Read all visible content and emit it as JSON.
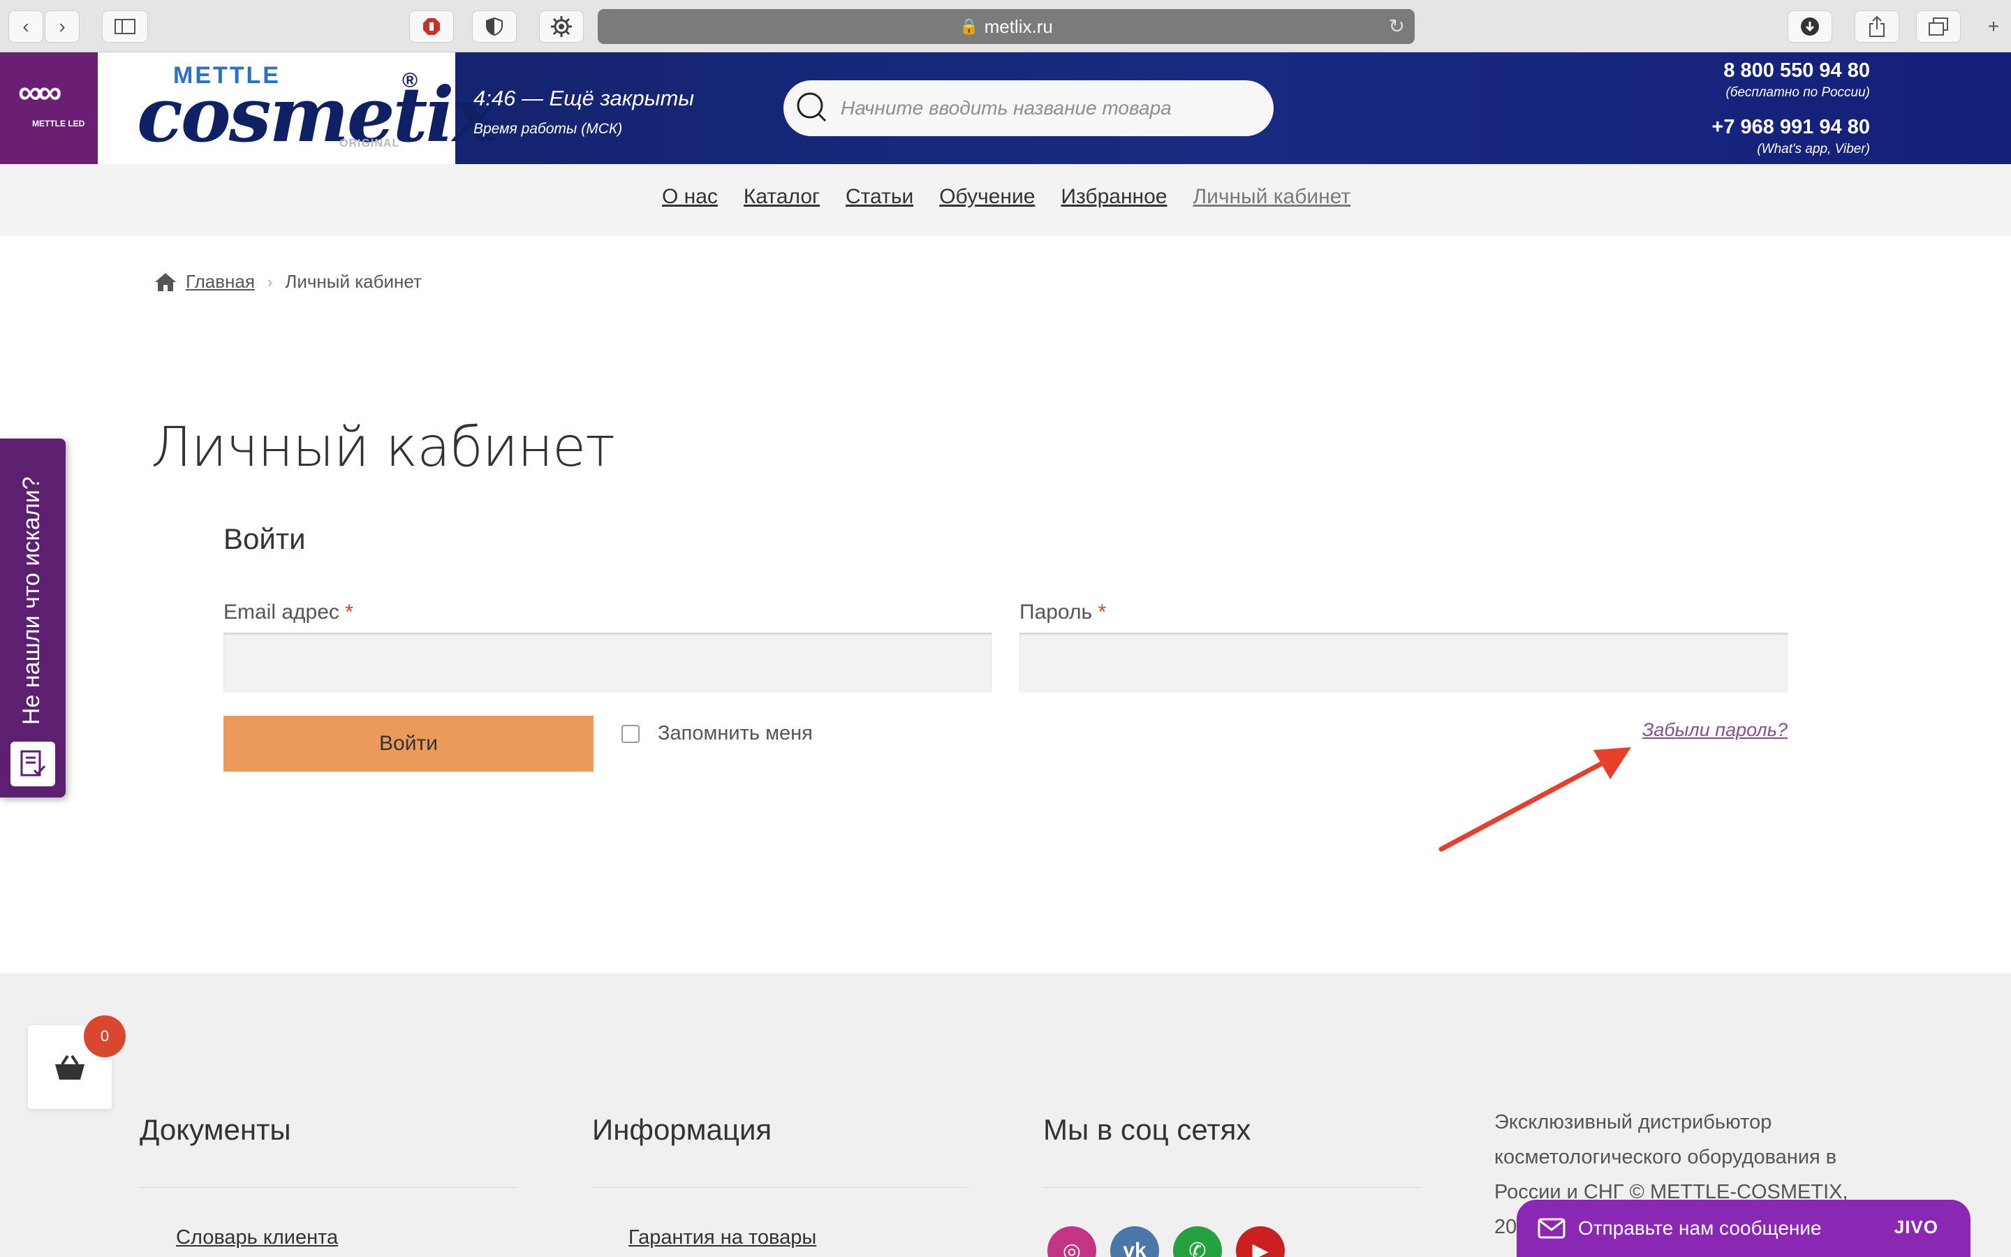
{
  "browser": {
    "url": "metlix.ru"
  },
  "header": {
    "led_brand": "METTLE LED",
    "logo_top": "METTLE",
    "logo_main": "cosmetix",
    "logo_reg": "®",
    "logo_sub": "ORIGINAL",
    "hours_status": "4:46 — Ещё закрыты",
    "hours_note": "Время работы (МСК)",
    "search_placeholder": "Начните вводить название товара",
    "phone1": "8 800 550 94 80",
    "phone1_note": "(бесплатно по России)",
    "phone2": "+7 968 991 94 80",
    "phone2_note": "(What's app, Viber)"
  },
  "nav": {
    "items": [
      {
        "label": "О нас"
      },
      {
        "label": "Каталог"
      },
      {
        "label": "Статьи"
      },
      {
        "label": "Обучение"
      },
      {
        "label": "Избранное"
      },
      {
        "label": "Личный кабинет"
      }
    ]
  },
  "breadcrumb": {
    "home": "Главная",
    "sep": "›",
    "current": "Личный кабинет"
  },
  "page": {
    "title": "Личный кабинет",
    "login_heading": "Войти",
    "email_label": "Email адрес",
    "password_label": "Пароль",
    "required_mark": "*",
    "login_button": "Войти",
    "remember_label": "Запомнить меня",
    "forgot_link": "Забыли пароль?"
  },
  "side_tab": {
    "label": "Не нашли что искали?"
  },
  "cart": {
    "count": "0"
  },
  "footer": {
    "col1_title": "Документы",
    "col1_link": "Словарь клиента",
    "col2_title": "Информация",
    "col2_link": "Гарантия на товары",
    "col3_title": "Мы в соц сетях",
    "about_line1": "Эксклюзивный дистрибьютор",
    "about_line2": "косметологического оборудования в",
    "about_line3": "России и СНГ © METTLE-COSMETIX,",
    "about_line4": "20"
  },
  "chat": {
    "label": "Отправьте нам сообщение",
    "brand": "JIVO"
  },
  "colors": {
    "header_blue": "#102064",
    "purple": "#6b1f74",
    "button_orange": "#eb9a5c",
    "jivo_purple": "#8a28b3",
    "badge_red": "#d9472e"
  }
}
